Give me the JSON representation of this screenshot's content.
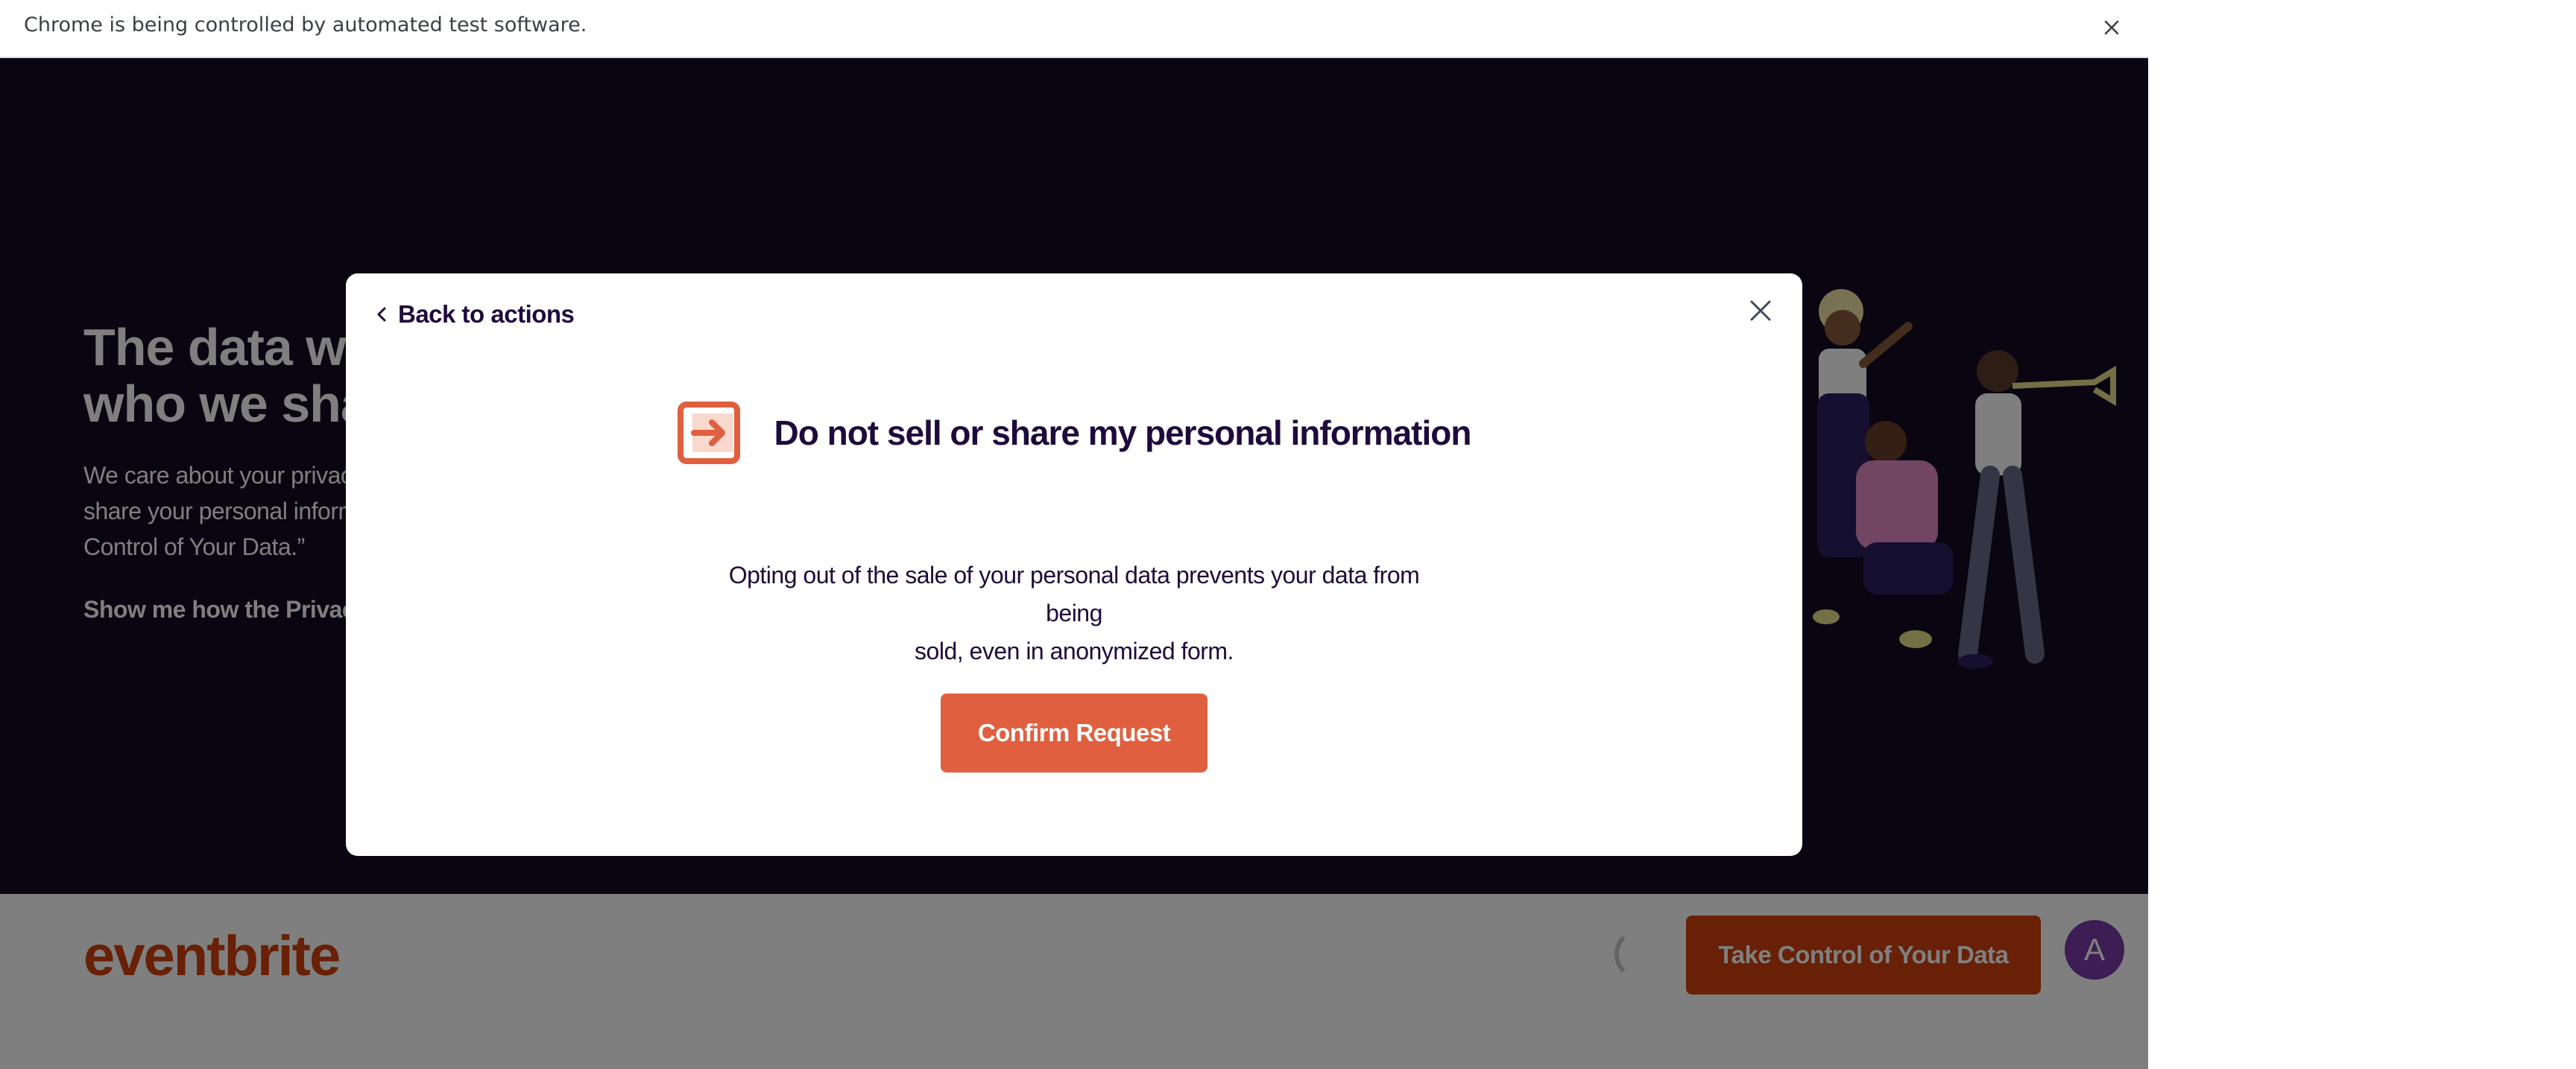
{
  "browser": {
    "infobar_text": "Chrome is being controlled by automated test software.",
    "close_icon": "close-icon"
  },
  "page": {
    "hero": {
      "title_line1": "The data we",
      "title_line2": "who we shar",
      "desc_line1": "We care about your privac",
      "desc_line2": "share your personal inform",
      "desc_line3": "Control of Your Data.”",
      "link": "Show me how the Privac"
    },
    "brand": "eventbrite",
    "take_control_label": "Take Control of Your Data",
    "avatar_letter": "A"
  },
  "modal": {
    "back_label": "Back to actions",
    "heading": "Do not sell or share my personal information",
    "body_line1": "Opting out of the sale of your personal data prevents your data from being",
    "body_line2": "sold, even in anonymized form.",
    "confirm_label": "Confirm Request",
    "icons": {
      "back": "chevron-left-icon",
      "close": "close-icon",
      "opt_out": "arrow-exit-icon"
    }
  },
  "colors": {
    "hero_bg": "#120a22",
    "brand_orange": "#d1410c",
    "confirm_orange": "#e05f3f",
    "heading_navy": "#1e0a3c",
    "avatar_purple": "#7a3ba8"
  }
}
